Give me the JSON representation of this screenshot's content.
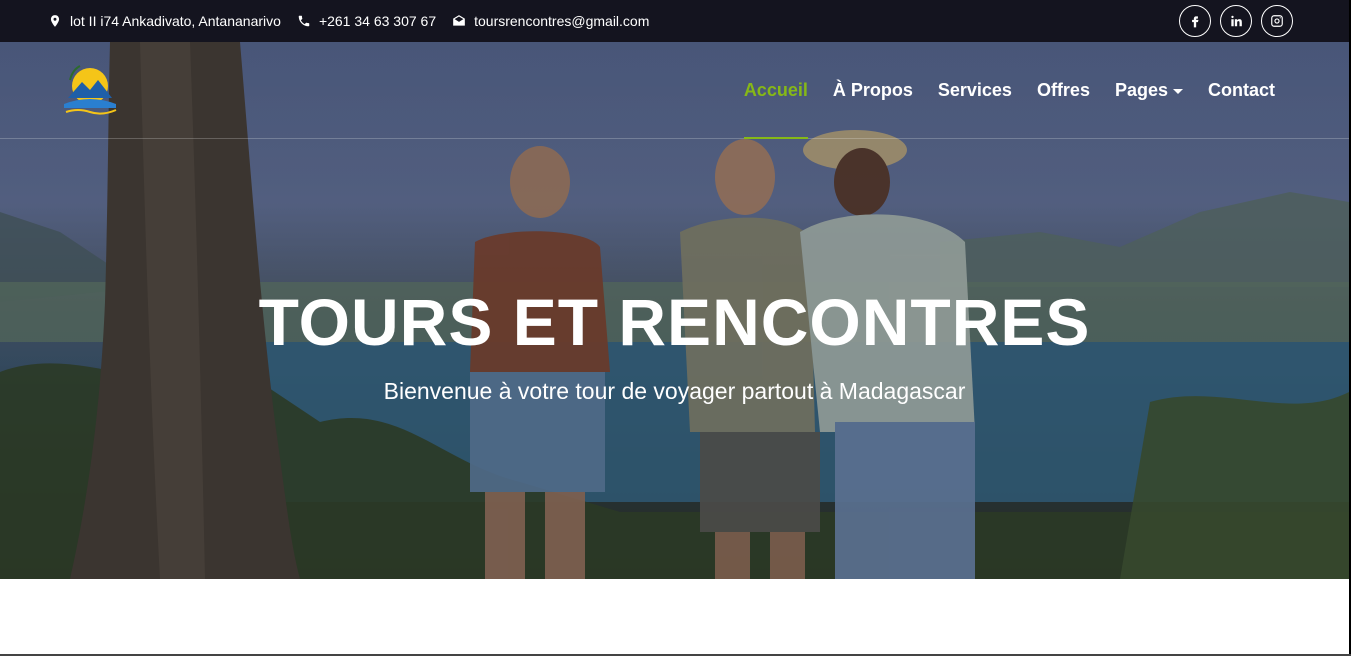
{
  "topbar": {
    "address": "lot II i74 Ankadivato, Antananarivo",
    "phone": "+261 34 63 307 67",
    "email": "toursrencontres@gmail.com",
    "socials": [
      "facebook-icon",
      "linkedin-icon",
      "instagram-icon"
    ]
  },
  "nav": {
    "items": [
      {
        "label": "Accueil",
        "active": true
      },
      {
        "label": "À Propos"
      },
      {
        "label": "Services"
      },
      {
        "label": "Offres"
      },
      {
        "label": "Pages",
        "dropdown": true
      },
      {
        "label": "Contact"
      }
    ]
  },
  "hero": {
    "title": "TOURS ET RENCONTRES",
    "subtitle": "Bienvenue à votre tour de voyager partout à Madagascar"
  },
  "colors": {
    "accent": "#86b817",
    "topbar": "#14141f"
  }
}
